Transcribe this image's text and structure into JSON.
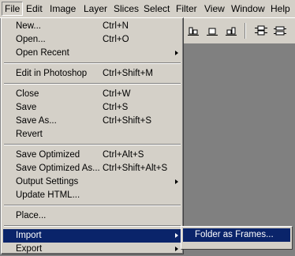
{
  "menubar": {
    "items": [
      "File",
      "Edit",
      "Image",
      "Layer",
      "Slices",
      "Select",
      "Filter",
      "View",
      "Window",
      "Help"
    ]
  },
  "toolbar": {
    "icons": [
      "align-left-icon",
      "align-center-icon",
      "align-right-icon",
      "distribute-top-icon",
      "distribute-center-icon"
    ]
  },
  "file_menu": {
    "items": [
      {
        "label": "New...",
        "shortcut": "Ctrl+N",
        "submenu": false
      },
      {
        "label": "Open...",
        "shortcut": "Ctrl+O",
        "submenu": false
      },
      {
        "label": "Open Recent",
        "shortcut": "",
        "submenu": true
      },
      {
        "label": "Edit in Photoshop",
        "shortcut": "Ctrl+Shift+M",
        "submenu": false
      },
      {
        "label": "Close",
        "shortcut": "Ctrl+W",
        "submenu": false
      },
      {
        "label": "Save",
        "shortcut": "Ctrl+S",
        "submenu": false
      },
      {
        "label": "Save As...",
        "shortcut": "Ctrl+Shift+S",
        "submenu": false
      },
      {
        "label": "Revert",
        "shortcut": "",
        "submenu": false
      },
      {
        "label": "Save Optimized",
        "shortcut": "Ctrl+Alt+S",
        "submenu": false
      },
      {
        "label": "Save Optimized As...",
        "shortcut": "Ctrl+Shift+Alt+S",
        "submenu": false
      },
      {
        "label": "Output Settings",
        "shortcut": "",
        "submenu": true
      },
      {
        "label": "Update HTML...",
        "shortcut": "",
        "submenu": false
      },
      {
        "label": "Place...",
        "shortcut": "",
        "submenu": false
      },
      {
        "label": "Import",
        "shortcut": "",
        "submenu": true,
        "highlighted": true
      },
      {
        "label": "Export",
        "shortcut": "",
        "submenu": true
      }
    ]
  },
  "import_submenu": {
    "items": [
      {
        "label": "Folder as Frames..."
      }
    ]
  },
  "colors": {
    "menu_bg": "#d4d0c8",
    "highlight": "#0a246a",
    "canvas_bg": "#808080"
  }
}
